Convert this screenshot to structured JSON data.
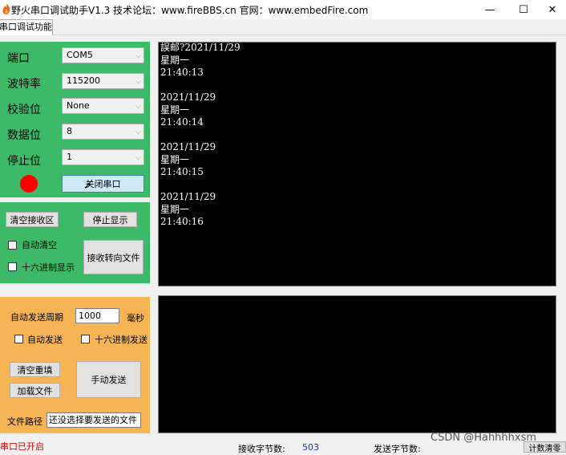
{
  "window": {
    "title": "野火串口调试助手V1.3    技术论坛：www.fireBBS.cn    官网：www.embedFire.com",
    "minimize": "—",
    "maximize": "☐",
    "close": "✕"
  },
  "tab": {
    "label": "串口调试功能"
  },
  "serial": {
    "port_label": "端口",
    "port_value": "COM5",
    "baud_label": "波特率",
    "baud_value": "115200",
    "parity_label": "校验位",
    "parity_value": "None",
    "data_label": "数据位",
    "data_value": "8",
    "stop_label": "停止位",
    "stop_value": "1",
    "indicator_color": "#ff0000",
    "close_port_button": "关闭串口"
  },
  "receive": {
    "clear_button": "清空接收区",
    "stop_display_button": "停止显示",
    "auto_clear_label": "自动清空",
    "hex_display_label": "十六进制显示",
    "save_to_file_button": "接收转向文件",
    "text": "誤邮?2021/11/29\n星期一\n21:40:13\n\n2021/11/29\n星期一\n21:40:14\n\n2021/11/29\n星期一\n21:40:15\n\n2021/11/29\n星期一\n21:40:16"
  },
  "send": {
    "auto_period_label": "自动发送周期",
    "period_value": "1000",
    "ms_label": "毫秒",
    "auto_send_label": "自动发送",
    "hex_send_label": "十六进制发送",
    "clear_button": "清空重填",
    "load_file_button": "加载文件",
    "manual_send_button": "手动发送",
    "file_path_label": "文件路径",
    "file_path_value": "还没选择要发送的文件"
  },
  "status_bar": {
    "port_status": "串口已开启",
    "recv_bytes_label": "接收字节数:",
    "recv_bytes_value": "503",
    "send_bytes_label": "发送字节数:",
    "clear_counter_button": "计数清零",
    "watermark": "CSDN @Hahhhhxsm"
  },
  "colors": {
    "green_panel": "#3dba68",
    "orange_panel": "#f7b455",
    "terminal_bg": "#000000",
    "status_red": "#d40000",
    "count_blue": "#1a3ab8"
  }
}
